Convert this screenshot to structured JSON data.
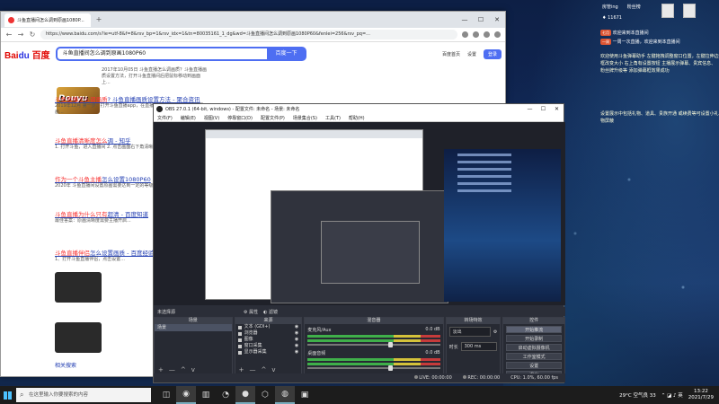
{
  "browser": {
    "tab_title": "斗鱼直播间怎么调到原画1080P...",
    "new_tab": "+",
    "url": "https://www.baidu.com/s?ie=utf-8&f=8&rsv_bp=1&rsv_idx=1&tn=80035161_1_dg&wd=斗鱼直播间怎么调到原画1080P60&fenlei=256&rsv_pq=...",
    "controls": [
      "—",
      "☐",
      "✕"
    ],
    "nav": [
      "←",
      "→",
      "↻"
    ]
  },
  "baidu": {
    "logo_main": "Bai",
    "logo_accent": "du",
    "logo_suffix": "百度",
    "query": "斗鱼直播间怎么调到原画1080P60",
    "search_btn": "百度一下",
    "right_links": [
      "百度首页",
      "设置"
    ],
    "login": "登录",
    "meme_text": "Douyu",
    "results": [
      {
        "title_hl": "斗鱼直播怎么调画质",
        "title": "? 斗鱼直播画质设置方法 - 聚合资讯",
        "snippet": "2017年10月05日 斗鱼直播怎么调画质？斗鱼直播画质设置方法，打开斗鱼直播间后把鼠标移动到画面上..."
      },
      {
        "title_hl": "斗鱼直播",
        "title": "怎么调画质 - 百度经验",
        "snippet": "2019年12月 第一步：打开斗鱼直播app，在直播间里选择清晰度，调至原画..."
      },
      {
        "title_hl": "斗鱼直播清晰度怎么",
        "title": "调 - 知乎",
        "snippet": "1. 打开斗鱼，进入直播间 2. 点击画面右下角清晰度..."
      },
      {
        "title_hl": "作为一个斗鱼主播",
        "title": "怎么设置1080P60",
        "snippet": "2020年 斗鱼直播间设置原画需要达到一定的等级..."
      },
      {
        "title_hl": "斗鱼直播为什么只有",
        "title": "超清 - 百度知道",
        "snippet": "最佳答案：原画清晰度需要主播开启..."
      },
      {
        "title_hl": "斗鱼直播伴侣",
        "title": "怎么设置画质 - 百度经验",
        "snippet": "1、打开斗鱼直播伴侣，点击设置..."
      }
    ],
    "footer": "相关搜索"
  },
  "obs": {
    "title": "OBS 27.0.1 (64-bit, windows) - 配置文件: 未命名 - 场景: 未命名",
    "menu": [
      "文件(F)",
      "编辑(E)",
      "视图(V)",
      "停靠窗口(D)",
      "配置文件(P)",
      "场景集合(S)",
      "工具(T)",
      "帮助(H)"
    ],
    "controls": [
      "—",
      "☐",
      "✕"
    ],
    "no_source": "未选择源",
    "hdr_props": "⚙ 属性",
    "hdr_filters": "◐ 滤镜",
    "docks": {
      "scenes_title": "场景",
      "sources_title": "来源",
      "mixer_title": "混音器",
      "trans_title": "转场特效",
      "ctrl_title": "控件"
    },
    "scenes": [
      "场景"
    ],
    "sources": [
      "文本 (GDI+)",
      "浏览器",
      "图像",
      "窗口采集",
      "显示器采集"
    ],
    "mixer": [
      {
        "name": "麦克风/Aux",
        "db": "0.0 dB"
      },
      {
        "name": "桌面音频",
        "db": "0.0 dB"
      }
    ],
    "transition": {
      "type": "淡出",
      "duration_label": "时长",
      "duration": "300 ms"
    },
    "controls_btns": [
      "开始推流",
      "开始录制",
      "启动虚拟摄像机",
      "工作室模式",
      "设置",
      "退出"
    ],
    "dock_foot": [
      "+",
      "—",
      "^",
      "v"
    ],
    "status": {
      "live": "LIVE: 00:00:00",
      "rec": "REC: 00:00:00",
      "cpu": "CPU: 1.0%, 60.00 fps"
    }
  },
  "overlay": {
    "top": [
      "房管ing",
      "粉丝榜"
    ],
    "viewers": "11671",
    "lines": [
      {
        "badge": "七月",
        "text": "欢迎来到本直播间"
      },
      {
        "badge": "一周",
        "text": "一周一次直播，欢迎来到本直播间"
      }
    ],
    "tip1": "欢迎使用斗鱼弹幕助手 左键拖拽调整窗口位置，左键拉伸边框改变大小 右上角有设置按钮 主播展示弹幕、贵宾信息、粉丝牌升级等 添加弹幕框效果成功",
    "tip2": "设置展示中包括礼物、道具、贵族开通 或续费等可设置小礼物屏蔽"
  },
  "taskbar": {
    "search_placeholder": "在这里输入你要搜索的内容",
    "apps": [
      "◫",
      "◉",
      "▥",
      "◔",
      "●",
      "⬡",
      "◍",
      "▣"
    ],
    "weather": "29°C 空气良 33",
    "time": "13:22",
    "date": "2021/7/29"
  },
  "colors": {
    "baidu_blue": "#4e6ef2",
    "baidu_red": "#e10602",
    "obs_bg": "#2b2e38",
    "taskbar": "#1c1c1c"
  }
}
